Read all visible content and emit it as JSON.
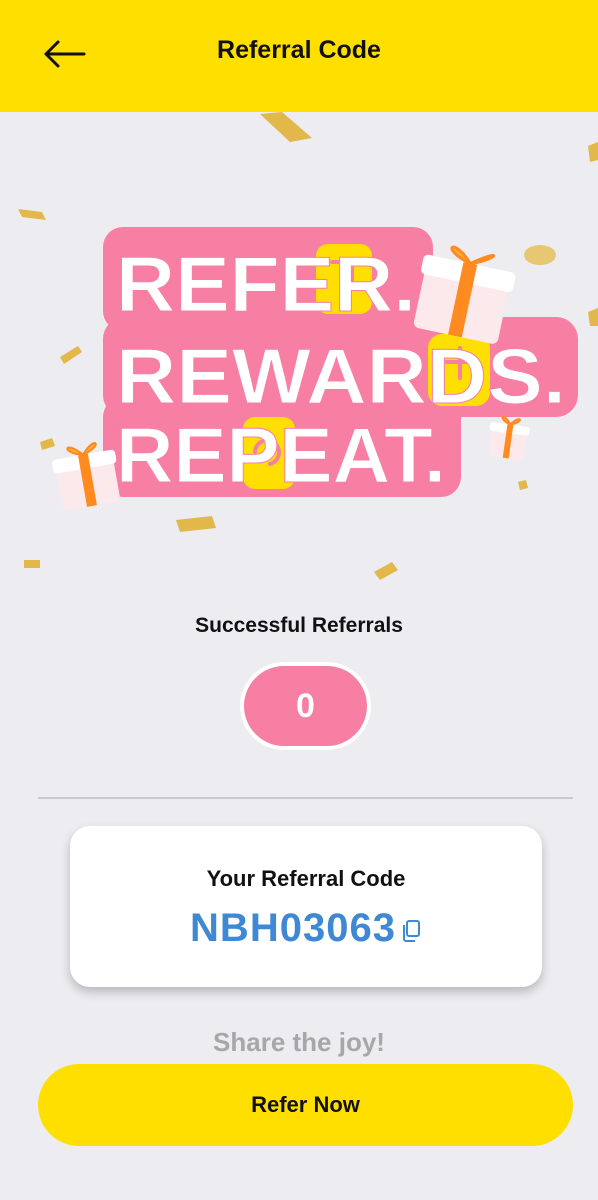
{
  "header": {
    "title": "Referral Code",
    "back_icon": "arrow-left-icon"
  },
  "banner": {
    "line1": "REFER.",
    "line2": "REWARDS.",
    "line3": "REPEAT.",
    "colors": {
      "pink": "#f77fa4",
      "yellow": "#ffdf00",
      "gift_orange": "#ff8a1f",
      "confetti_gold": "#e2b84a"
    }
  },
  "referrals": {
    "label": "Successful Referrals",
    "count": "0"
  },
  "code_card": {
    "label": "Your Referral Code",
    "code": "NBH03063",
    "copy_icon": "copy-icon"
  },
  "share": {
    "text": "Share the joy!"
  },
  "cta": {
    "label": "Refer Now"
  },
  "colors": {
    "accent": "#ffdf00",
    "background": "#ececf1",
    "code_blue": "#3f88d4"
  }
}
